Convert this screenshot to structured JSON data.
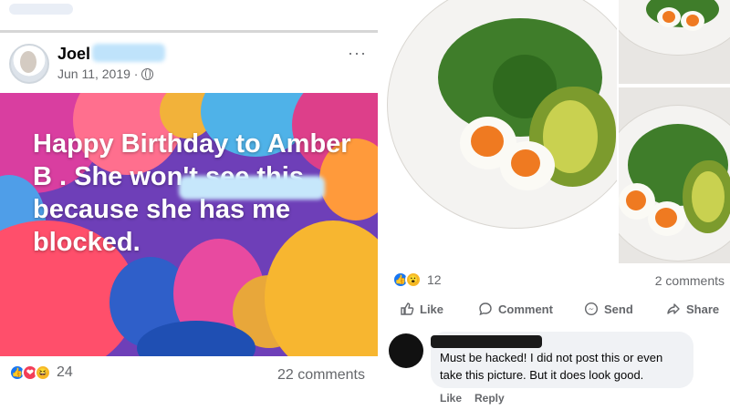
{
  "left_post": {
    "author_name": "Joel",
    "date": "Jun 11, 2019 ·",
    "more_menu": "···",
    "photo_text": "Happy Birthday to Amber B . She won't see this because she has me blocked.",
    "reaction_icons": [
      "like-icon",
      "love-icon",
      "haha-icon"
    ],
    "reaction_count": "24",
    "comments": "22 comments"
  },
  "right_post": {
    "reaction_icons": [
      "like-icon",
      "wow-icon"
    ],
    "reaction_count": "12",
    "comments": "2 comments",
    "actions": {
      "like": "Like",
      "comment": "Comment",
      "send": "Send",
      "share": "Share"
    },
    "comment": {
      "text": "Must be hacked! I did not post this or even take this picture. But it does look good.",
      "like": "Like",
      "reply": "Reply"
    }
  },
  "colors": {
    "facebook_blue": "#1877f2",
    "secondary_text": "#65676b",
    "bubble_bg": "#f0f2f5"
  }
}
